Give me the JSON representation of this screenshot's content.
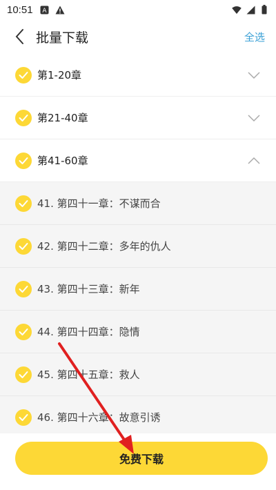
{
  "status_bar": {
    "time": "10:51",
    "icons_left": [
      "font-a-icon",
      "warning-icon"
    ],
    "icons_right": [
      "wifi-icon",
      "signal-icon",
      "battery-icon"
    ]
  },
  "header": {
    "title": "批量下载",
    "select_all": "全选"
  },
  "groups": [
    {
      "label": "第1-20章",
      "expanded": false
    },
    {
      "label": "第21-40章",
      "expanded": false
    },
    {
      "label": "第41-60章",
      "expanded": true
    }
  ],
  "chapters": [
    {
      "label": "41. 第四十一章：不谋而合"
    },
    {
      "label": "42. 第四十二章：多年的仇人"
    },
    {
      "label": "43. 第四十三章：新年"
    },
    {
      "label": "44. 第四十四章：隐情"
    },
    {
      "label": "45. 第四十五章：救人"
    },
    {
      "label": "46. 第四十六章：故意引诱"
    }
  ],
  "download_button": {
    "label": "免费下载"
  },
  "colors": {
    "accent_yellow": "#fdd836",
    "link_blue": "#3aa0d6",
    "annotation_red": "#e02020"
  }
}
